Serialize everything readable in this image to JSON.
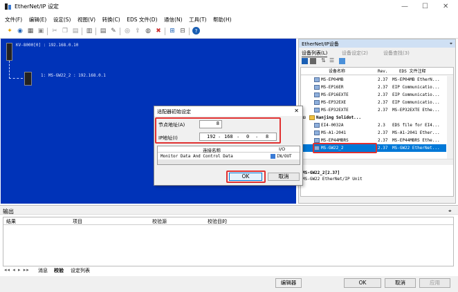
{
  "window": {
    "title": "EtherNet/IP 设定",
    "min": "—",
    "max": "☐",
    "close": "✕"
  },
  "menu": [
    "文件(F)",
    "编辑(E)",
    "设定(S)",
    "视图(V)",
    "转换(C)",
    "EDS 文件(D)",
    "通信(N)",
    "工具(T)",
    "帮助(H)"
  ],
  "network": {
    "controller": "KV-8000[0] : 192.168.0.10",
    "node": "1: MS-GW22_2 : 192.168.0.1"
  },
  "panel": {
    "title": "EtherNet/IP设备",
    "pin": "⌖",
    "tabs": [
      "设备列表(L)",
      "设备设定(2)",
      "设备查找(3)"
    ],
    "headers": [
      "设备名称",
      "Rev.",
      "EDS 文件注释"
    ],
    "rows": [
      {
        "name": "MS-EP04MB",
        "rev": "2.37",
        "note": "MS-EP04MB EtherN..."
      },
      {
        "name": "MS-EP16ER",
        "rev": "2.37",
        "note": "EIP Communicatio..."
      },
      {
        "name": "MS-EP16EXTE",
        "rev": "2.37",
        "note": "EIP Communicatio..."
      },
      {
        "name": "MS-EP32EXE",
        "rev": "2.37",
        "note": "EIP Communicatio..."
      },
      {
        "name": "MS-EP32EXTE",
        "rev": "2.37",
        "note": "MS-EP32EXTE Ethe..."
      },
      {
        "name": "Nanjing Solidot...",
        "rev": "",
        "note": ""
      },
      {
        "name": "EI4-0032A",
        "rev": "2.3",
        "note": "EDS file for EI4..."
      },
      {
        "name": "MS-A1-2041",
        "rev": "2.37",
        "note": "MS-A1-2041 Ether..."
      },
      {
        "name": "MS-EP44MBRS",
        "rev": "2.37",
        "note": "MS-EP44MBRS Ethe..."
      },
      {
        "name": "MS-GW22_2",
        "rev": "2.37",
        "note": "MS-GW22 EtherNet..."
      }
    ],
    "detail_title": "MS-GW22_2[2.37]",
    "detail_text": "MS-GW22 EtherNet/IP Unit"
  },
  "dialog": {
    "title": "适配器初始设定",
    "node_label": "节点地址(A)",
    "node_value": "8",
    "ip_label": "IP地址(I)",
    "ip": [
      "192",
      "168",
      "0",
      "8"
    ],
    "col_name": "连接名称",
    "col_io": "I/O",
    "conn_name": "Monitor Data And Control Data",
    "conn_io": "IN/OUT",
    "ok": "OK",
    "cancel": "取消"
  },
  "output": {
    "title": "输出",
    "cols": [
      "结果",
      "项目",
      "校验源",
      "校验目的"
    ],
    "tabs": [
      "消息",
      "校验",
      "设定列表"
    ]
  },
  "status": {
    "editor": "编辑器",
    "ok": "OK",
    "cancel": "取消",
    "apply": "应用"
  }
}
